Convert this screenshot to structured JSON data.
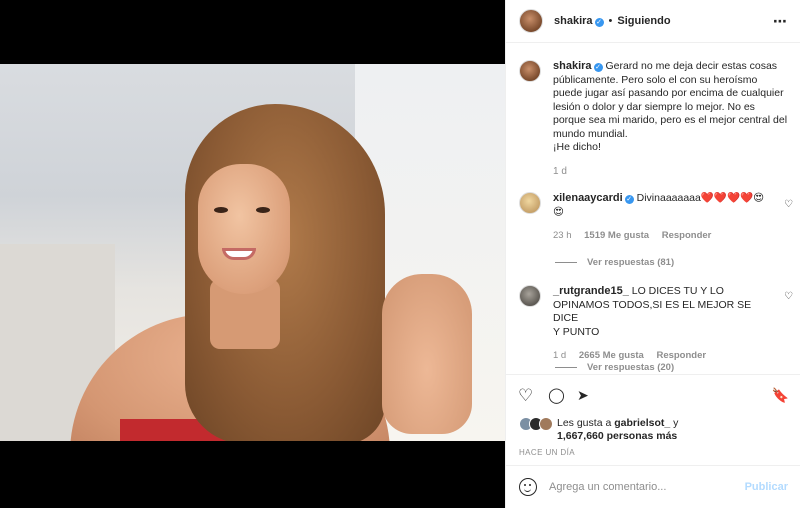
{
  "post": {
    "author": "shakira",
    "verified_mark": "✓",
    "follow_separator": "•",
    "follow_status": "Siguiendo",
    "more_icon": "⋯",
    "caption_lines": [
      "Gerard no me deja decir estas cosas",
      "públicamente. Pero solo el con su heroísmo",
      "puede jugar así pasando por encima de cualquier",
      "lesión o dolor y dar siempre lo mejor. No es",
      "porque sea mi marido, pero es el mejor central del",
      "mundo mundial.",
      "¡He dicho!"
    ],
    "caption_time": "1 d"
  },
  "comments": [
    {
      "user": "xilenaaycardi",
      "verified": true,
      "text_line1": "Divinaaaaaaa❤️❤️❤️❤️😍",
      "text_line2": "😍",
      "time": "23 h",
      "likes": "1519 Me gusta",
      "reply": "Responder",
      "replies": "Ver respuestas (81)"
    },
    {
      "user": "_rutgrande15_",
      "verified": false,
      "text_line1": "LO DICES TU Y LO",
      "text_line2": "OPINAMOS TODOS,SI ES EL MEJOR SE DICE",
      "text_line3": "Y PUNTO",
      "time": "1 d",
      "likes": "2665 Me gusta",
      "reply": "Responder",
      "replies": "Ver respuestas (20)"
    }
  ],
  "actions": {
    "like_icon": "♡",
    "comment_icon": "◯",
    "share_icon": "➤",
    "save_icon": "🔖"
  },
  "likes_summary": {
    "prefix": "Les gusta a ",
    "user": "gabrielsot_",
    "middle": " y",
    "count": "1,667,660 personas más"
  },
  "posted_ago": "HACE UN DÍA",
  "add_comment": {
    "placeholder": "Agrega un comentario...",
    "publish_label": "Publicar"
  },
  "colors": {
    "verified": "#3897f0",
    "publish_disabled": "#b3dbff",
    "dress": "#c22a2e"
  }
}
